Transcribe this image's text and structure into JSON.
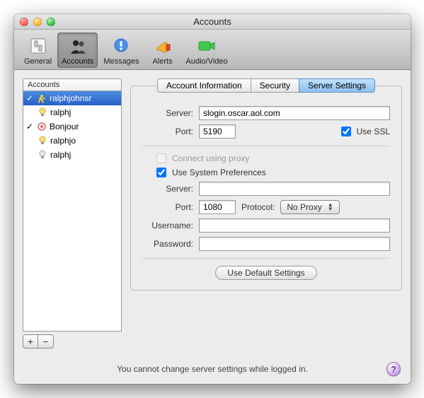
{
  "window": {
    "title": "Accounts"
  },
  "toolbar": {
    "items": [
      {
        "label": "General"
      },
      {
        "label": "Accounts"
      },
      {
        "label": "Messages"
      },
      {
        "label": "Alerts"
      },
      {
        "label": "Audio/Video"
      }
    ]
  },
  "sidebar": {
    "header": "Accounts",
    "accounts": [
      {
        "label": "ralphjohnsr"
      },
      {
        "label": "ralphj"
      },
      {
        "label": "Bonjour"
      },
      {
        "label": "ralphjo"
      },
      {
        "label": "ralphj"
      }
    ],
    "add": "+",
    "remove": "−"
  },
  "tabs": {
    "info": "Account Information",
    "security": "Security",
    "server": "Server Settings"
  },
  "form": {
    "server_label": "Server:",
    "server_value": "slogin.oscar.aol.com",
    "port_label": "Port:",
    "port_value": "5190",
    "use_ssl": "Use SSL",
    "connect_proxy": "Connect using proxy",
    "use_sysprefs": "Use System Preferences",
    "proxy_server_label": "Server:",
    "proxy_server_value": "",
    "proxy_port_label": "Port:",
    "proxy_port_value": "1080",
    "protocol_label": "Protocol:",
    "protocol_value": "No Proxy",
    "username_label": "Username:",
    "username_value": "",
    "password_label": "Password:",
    "password_value": "",
    "defaults_button": "Use Default Settings"
  },
  "footer": {
    "message": "You cannot change server settings while logged in.",
    "help": "?"
  }
}
